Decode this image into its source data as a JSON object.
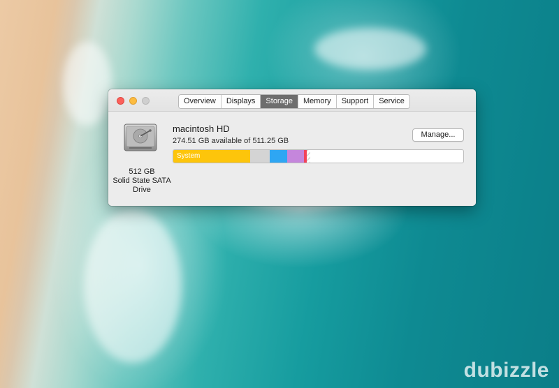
{
  "window": {
    "tabs": [
      {
        "label": "Overview",
        "active": false
      },
      {
        "label": "Displays",
        "active": false
      },
      {
        "label": "Storage",
        "active": true
      },
      {
        "label": "Memory",
        "active": false
      },
      {
        "label": "Support",
        "active": false
      },
      {
        "label": "Service",
        "active": false
      }
    ]
  },
  "drive": {
    "icon": "hard-drive-icon",
    "capacity": "512 GB",
    "type_line1": "Solid State SATA",
    "type_line2": "Drive"
  },
  "volume": {
    "name": "macintosh HD",
    "available": "274.51 GB available of 511.25 GB",
    "manage_label": "Manage..."
  },
  "storage_bar": {
    "total_gb": 511.25,
    "segments": [
      {
        "name": "system",
        "label": "System",
        "fraction": 0.264,
        "color": "#fdc50b"
      },
      {
        "name": "other",
        "label": "",
        "fraction": 0.067,
        "color": "#d4d4d4"
      },
      {
        "name": "apps",
        "label": "",
        "fraction": 0.06,
        "color": "#2ea6f3"
      },
      {
        "name": "documents",
        "label": "",
        "fraction": 0.059,
        "color": "#c586dc"
      },
      {
        "name": "photos",
        "label": "",
        "fraction": 0.009,
        "color": "#f2425a"
      },
      {
        "name": "purgeable",
        "label": "",
        "fraction": 0.012,
        "color": "hatched"
      }
    ]
  },
  "watermark": {
    "text": "dubizzle"
  }
}
